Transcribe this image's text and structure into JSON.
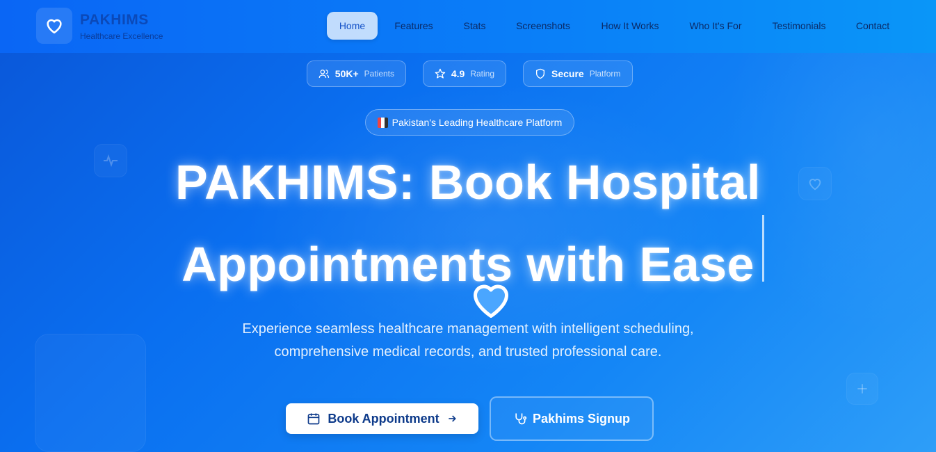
{
  "brand": {
    "name": "PAKHIMS",
    "tagline": "Healthcare Excellence"
  },
  "nav": {
    "items": [
      {
        "label": "Home",
        "active": true
      },
      {
        "label": "Features"
      },
      {
        "label": "Stats"
      },
      {
        "label": "Screenshots"
      },
      {
        "label": "How It Works"
      },
      {
        "label": "Who It's For"
      },
      {
        "label": "Testimonials"
      },
      {
        "label": "Contact"
      }
    ]
  },
  "stats": [
    {
      "icon": "users-icon",
      "value": "50K+",
      "label": "Patients"
    },
    {
      "icon": "star-icon",
      "value": "4.9",
      "label": "Rating"
    },
    {
      "icon": "shield-icon",
      "value": "Secure",
      "label": "Platform"
    }
  ],
  "badge": {
    "icon": "pakistan-flag-icon",
    "text": "Pakistan's Leading Healthcare Platform"
  },
  "hero": {
    "headline_line1": "PAKHIMS: Book Hospital",
    "headline_line2": "Appointments with Ease",
    "subtext_line1": "Experience seamless healthcare management with intelligent scheduling,",
    "subtext_line2": "comprehensive medical records, and trusted professional care."
  },
  "cta": {
    "primary_label": "Book Appointment",
    "primary_icon": "calendar-icon",
    "secondary_label": "Pakhims Signup",
    "secondary_icon": "stethoscope-icon"
  },
  "colors": {
    "primary_blue": "#0a66f5",
    "light_blue": "#2e9ef8",
    "button_text": "#0d3a8a"
  }
}
